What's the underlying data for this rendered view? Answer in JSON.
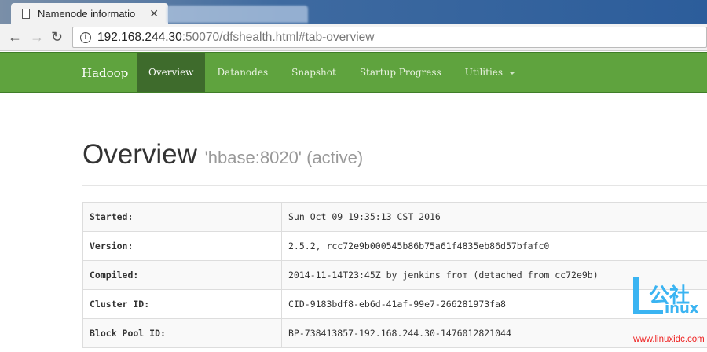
{
  "browser": {
    "tab_title": "Namenode informatio",
    "url_host": "192.168.244.30",
    "url_rest": ":50070/dfshealth.html#tab-overview"
  },
  "navbar": {
    "brand": "Hadoop",
    "items": [
      {
        "label": "Overview"
      },
      {
        "label": "Datanodes"
      },
      {
        "label": "Snapshot"
      },
      {
        "label": "Startup Progress"
      },
      {
        "label": "Utilities"
      }
    ]
  },
  "page": {
    "title": "Overview",
    "subtitle": "'hbase:8020' (active)"
  },
  "overview": [
    {
      "key": "Started:",
      "value": "Sun Oct 09 19:35:13 CST 2016"
    },
    {
      "key": "Version:",
      "value": "2.5.2, rcc72e9b000545b86b75a61f4835eb86d57bfafc0"
    },
    {
      "key": "Compiled:",
      "value": "2014-11-14T23:45Z by jenkins from (detached from cc72e9b)"
    },
    {
      "key": "Cluster ID:",
      "value": "CID-9183bdf8-eb6d-41af-99e7-266281973fa8"
    },
    {
      "key": "Block Pool ID:",
      "value": "BP-738413857-192.168.244.30-1476012821044"
    }
  ],
  "watermark": {
    "cn": "公社",
    "linux": "inux",
    "url": "www.linuxidc.com"
  }
}
